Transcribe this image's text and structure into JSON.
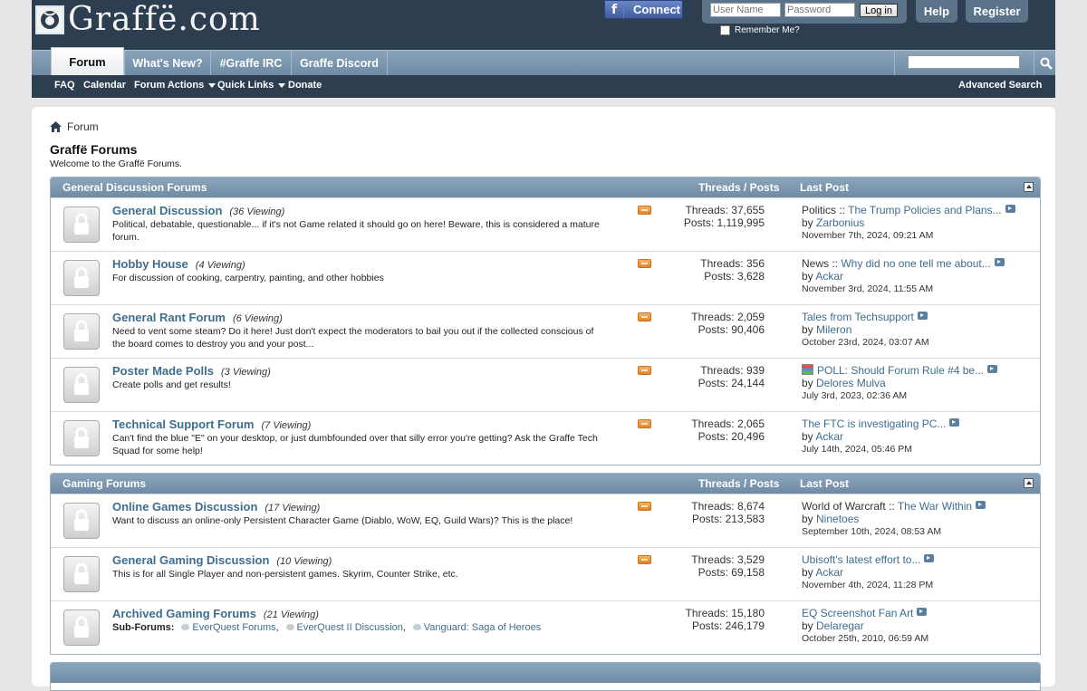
{
  "site": {
    "logo_text": "Graffë.com"
  },
  "header": {
    "fb_label": "Connect",
    "login": {
      "user_placeholder": "User Name",
      "pass_placeholder": "Password",
      "button": "Log in",
      "remember": "Remember Me?"
    },
    "help": "Help",
    "register": "Register"
  },
  "nav": {
    "tabs": [
      "Forum",
      "What's New?",
      "#Graffe IRC",
      "Graffe Discord"
    ],
    "sub": [
      "FAQ",
      "Calendar",
      "Forum Actions",
      "Quick Links",
      "Donate"
    ],
    "advanced_search": "Advanced Search"
  },
  "breadcrumb": "Forum",
  "page": {
    "title": "Graffë Forums",
    "description": "Welcome to the Graffë Forums."
  },
  "sections": [
    {
      "title": "General Discussion Forums",
      "tp_header": "Threads / Posts",
      "lp_header": "Last Post",
      "forums": [
        {
          "name": "General Discussion",
          "viewing": "(36 Viewing)",
          "desc": "Political, debatable, questionable... if it's not Game related it should go on here! Beware, this is considered a mature forum.",
          "threads": "Threads: 37,655",
          "posts": "Posts: 1,119,995",
          "lp_prefix": "Politics :: ",
          "lp_title": "The Trump Policies and Plans...",
          "lp_by": "by ",
          "lp_user": "Zarbonius",
          "lp_date": "November 7th, 2024, 09:21 AM"
        },
        {
          "name": "Hobby House",
          "viewing": "(4 Viewing)",
          "desc": "For discussion of cooking, carpentry, painting, and other hobbies",
          "threads": "Threads: 356",
          "posts": "Posts: 3,628",
          "lp_prefix": "News :: ",
          "lp_title": "Why did no one tell me about...",
          "lp_by": "by ",
          "lp_user": "Ackar",
          "lp_date": "November 3rd, 2024, 11:55 AM"
        },
        {
          "name": "General Rant Forum",
          "viewing": "(6 Viewing)",
          "desc": "Need to vent some steam? Do it here! Just don't expect the moderators to bail you out if the collected conscious of the board comes to destroy you and your post...",
          "threads": "Threads: 2,059",
          "posts": "Posts: 90,406",
          "lp_prefix": "",
          "lp_title": "Tales from Techsupport",
          "lp_by": "by ",
          "lp_user": "Mileron",
          "lp_date": "October 23rd, 2024, 03:07 AM"
        },
        {
          "name": "Poster Made Polls",
          "viewing": "(3 Viewing)",
          "desc": "Create polls and get results!",
          "threads": "Threads: 939",
          "posts": "Posts: 24,144",
          "lp_prefix": "",
          "lp_title": "POLL: Should Forum Rule #4 be...",
          "lp_by": "by ",
          "lp_user": "Delores Mulva",
          "lp_date": "July 3rd, 2023, 02:36 AM",
          "poll": true
        },
        {
          "name": "Technical Support Forum",
          "viewing": "(7 Viewing)",
          "desc": "Can't find the blue \"E\" on your desktop, or just dumbfounded over that silly error you're getting? Ask the Graffe Tech Squad for some help!",
          "threads": "Threads: 2,065",
          "posts": "Posts: 20,496",
          "lp_prefix": "",
          "lp_title": "The FTC is investigating PC...",
          "lp_by": "by ",
          "lp_user": "Ackar",
          "lp_date": "July 14th, 2024, 05:46 PM"
        }
      ]
    },
    {
      "title": "Gaming Forums",
      "tp_header": "Threads / Posts",
      "lp_header": "Last Post",
      "forums": [
        {
          "name": "Online Games Discussion",
          "viewing": "(17 Viewing)",
          "desc": "Want to discuss an online-only Persistent Character Game (Diablo, WoW, EQ, Guild Wars)? This is the place!",
          "threads": "Threads: 8,674",
          "posts": "Posts: 213,583",
          "lp_prefix": "World of Warcraft :: ",
          "lp_title": "The War Within",
          "lp_by": "by ",
          "lp_user": "Ninetoes",
          "lp_date": "September 10th, 2024, 08:53 AM"
        },
        {
          "name": "General Gaming Discussion",
          "viewing": "(10 Viewing)",
          "desc": "This is for all Single Player and non-persistent games. Skyrim, Counter Strike, etc.",
          "threads": "Threads: 3,529",
          "posts": "Posts: 69,158",
          "lp_prefix": "",
          "lp_title": "Ubisoft's latest effort to...",
          "lp_by": "by ",
          "lp_user": "Ackar",
          "lp_date": "November 4th, 2024, 11:28 PM"
        },
        {
          "name": "Archived Gaming Forums",
          "viewing": "(21 Viewing)",
          "desc": "",
          "subforums_label": "Sub-Forums:",
          "subforums": [
            "EverQuest Forums",
            "EverQuest II Discussion",
            "Vanguard: Saga of Heroes"
          ],
          "threads": "Threads: 15,180",
          "posts": "Posts: 246,179",
          "lp_prefix": "",
          "lp_title": "EQ Screenshot Fan Art",
          "lp_by": "by ",
          "lp_user": "Delaregar",
          "lp_date": "October 25th, 2010, 06:59 AM"
        }
      ]
    }
  ],
  "colors": {
    "header_bg": "#2c3e50",
    "nav_bg": "#7f99b1",
    "link": "#3e6d8e",
    "rss": "#e58525"
  }
}
